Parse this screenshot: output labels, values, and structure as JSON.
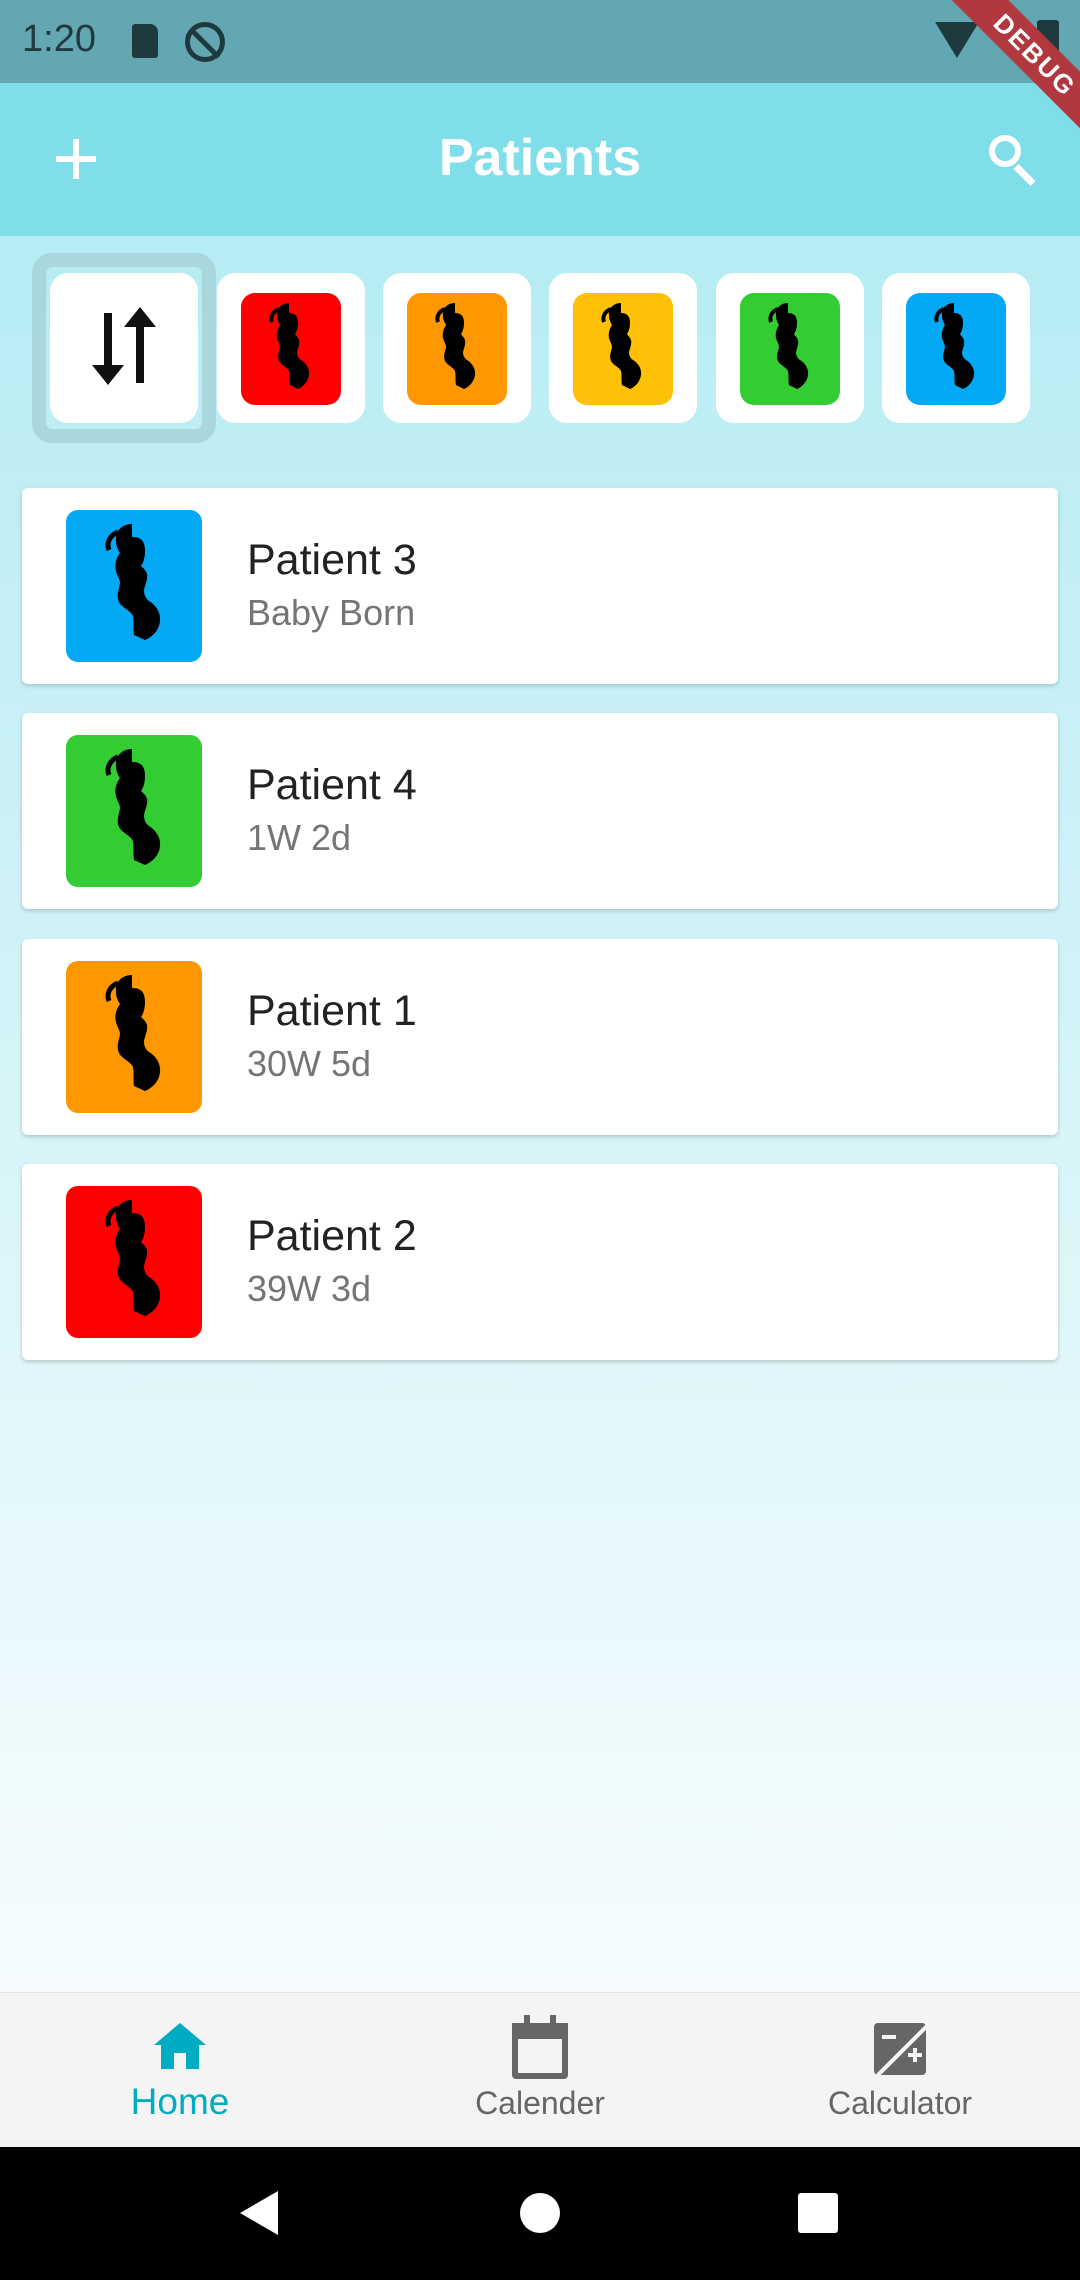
{
  "status_bar": {
    "time": "1:20",
    "debug_label": "DEBUG"
  },
  "app_bar": {
    "title": "Patients",
    "add_icon": "plus-icon",
    "search_icon": "search-icon"
  },
  "filters": {
    "sort_icon": "sort-arrows-icon",
    "chips": [
      {
        "name": "red",
        "color": "#ff0000"
      },
      {
        "name": "orange",
        "color": "#ff9800"
      },
      {
        "name": "yellow",
        "color": "#ffc107"
      },
      {
        "name": "green",
        "color": "#33cc33"
      },
      {
        "name": "blue",
        "color": "#03a9f4"
      }
    ]
  },
  "patients": [
    {
      "name": "Patient 3",
      "status": "Baby Born",
      "color": "#03a9f4"
    },
    {
      "name": "Patient 4",
      "status": "1W 2d",
      "color": "#33cc33"
    },
    {
      "name": "Patient 1",
      "status": "30W 5d",
      "color": "#ff9800"
    },
    {
      "name": "Patient 2",
      "status": "39W 3d",
      "color": "#ff0000"
    }
  ],
  "bottom_nav": {
    "items": [
      {
        "label": "Home",
        "icon": "home-icon",
        "active": true
      },
      {
        "label": "Calender",
        "icon": "calendar-icon",
        "active": false
      },
      {
        "label": "Calculator",
        "icon": "calculator-icon",
        "active": false
      }
    ],
    "active_color": "#00acc1"
  }
}
